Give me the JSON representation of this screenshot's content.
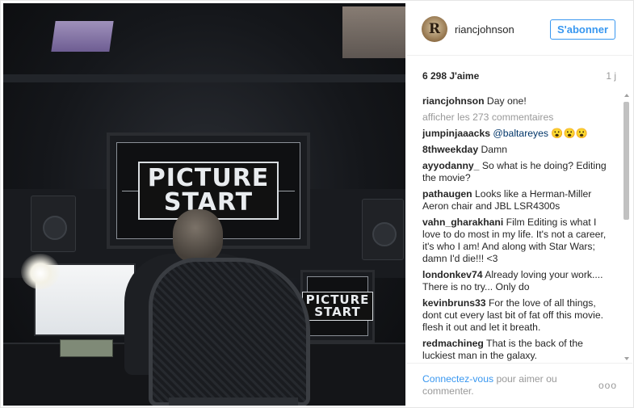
{
  "photo": {
    "monitor_text_line1": "PICTURE",
    "monitor_text_line2": "START",
    "small_monitor_line1": "PICTURE",
    "small_monitor_line2": "START"
  },
  "post": {
    "username": "riancjohnson",
    "avatar_letter": "R",
    "follow_label": "S'abonner",
    "likes": "6 298 J'aime",
    "time": "1 j"
  },
  "caption": {
    "user": "riancjohnson",
    "text": "Day one!"
  },
  "view_all": "afficher les 273 commentaires",
  "comments": [
    {
      "user": "jumpinjaaacks",
      "mention": "@baltareyes",
      "text": "😮😮😮"
    },
    {
      "user": "8thweekday",
      "mention": "",
      "text": "Damn"
    },
    {
      "user": "ayyodanny_",
      "mention": "",
      "text": "So what is he doing? Editing the movie?"
    },
    {
      "user": "pathaugen",
      "mention": "",
      "text": "Looks like a Herman-Miller Aeron chair and JBL LSR4300s"
    },
    {
      "user": "vahn_gharakhani",
      "mention": "",
      "text": "Film Editing is what I love to do most in my life. It's not a career, it's who I am! And along with Star Wars; damn I'd die!!! <3"
    },
    {
      "user": "londonkev74",
      "mention": "",
      "text": "Already loving your work.... There is no try... Only do"
    },
    {
      "user": "kevinbruns33",
      "mention": "",
      "text": "For the love of all things, dont cut every last bit of fat off this movie. flesh it out and let it breath."
    },
    {
      "user": "redmachineg",
      "mention": "",
      "text": "That is the back of the luckiest man in the galaxy."
    }
  ],
  "footer": {
    "login_link": "Connectez-vous",
    "login_rest": "pour aimer ou commenter.",
    "more": "ooo"
  },
  "colors": {
    "accent": "#3897f0",
    "muted": "#999999",
    "text": "#262626"
  }
}
